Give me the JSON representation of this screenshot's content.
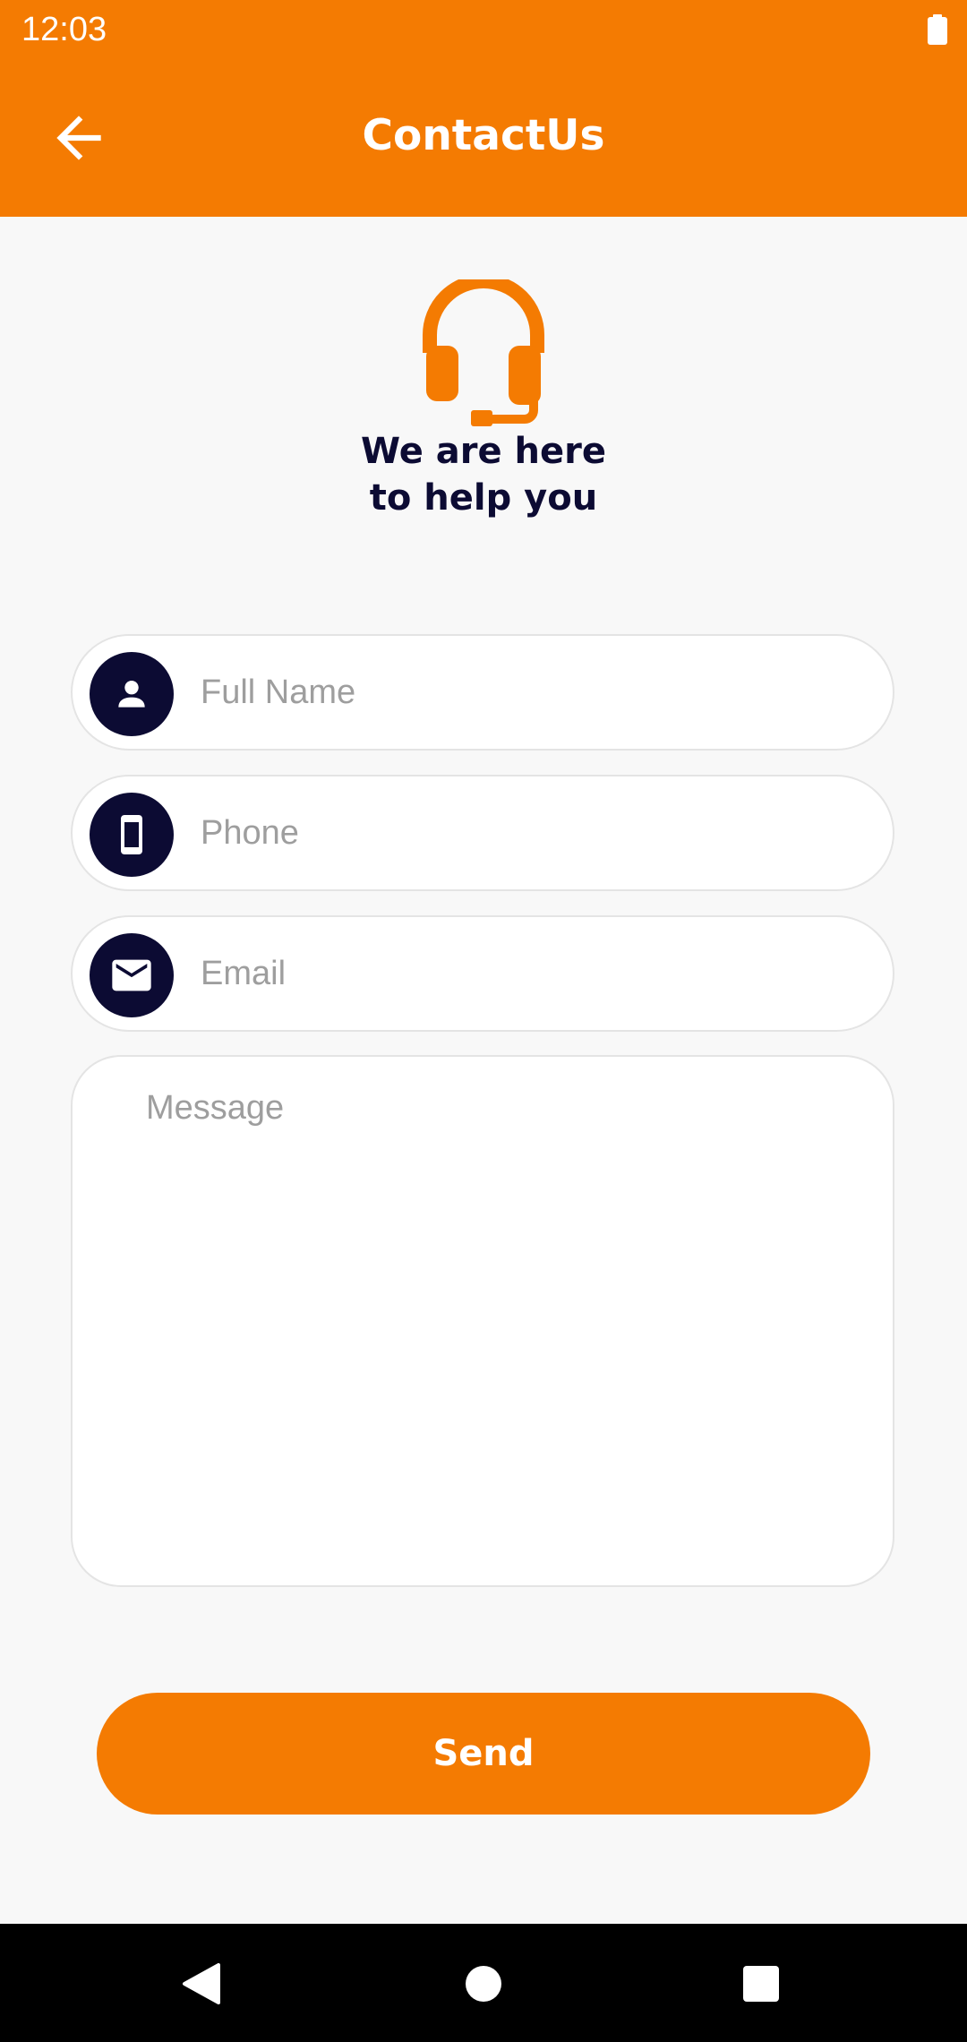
{
  "status_bar": {
    "time": "12:03",
    "battery_icon": "battery-full-icon"
  },
  "app_bar": {
    "title": "ContactUs",
    "back_icon": "arrow-back-icon"
  },
  "hero": {
    "icon": "headset-icon",
    "line1": "We are here",
    "line2": "to help you"
  },
  "form": {
    "full_name": {
      "placeholder": "Full Name",
      "value": "",
      "icon": "person-icon"
    },
    "phone": {
      "placeholder": "Phone",
      "value": "",
      "icon": "smartphone-icon"
    },
    "email": {
      "placeholder": "Email",
      "value": "",
      "icon": "mail-icon"
    },
    "message": {
      "placeholder": "Message",
      "value": ""
    },
    "send_label": "Send"
  },
  "colors": {
    "accent": "#f47b02",
    "dark_navy": "#0c0b33",
    "background": "#f8f8f8",
    "placeholder": "#9e9e9e"
  },
  "nav_bar": {
    "back_icon": "nav-back-icon",
    "home_icon": "nav-home-icon",
    "recents_icon": "nav-recents-icon"
  }
}
